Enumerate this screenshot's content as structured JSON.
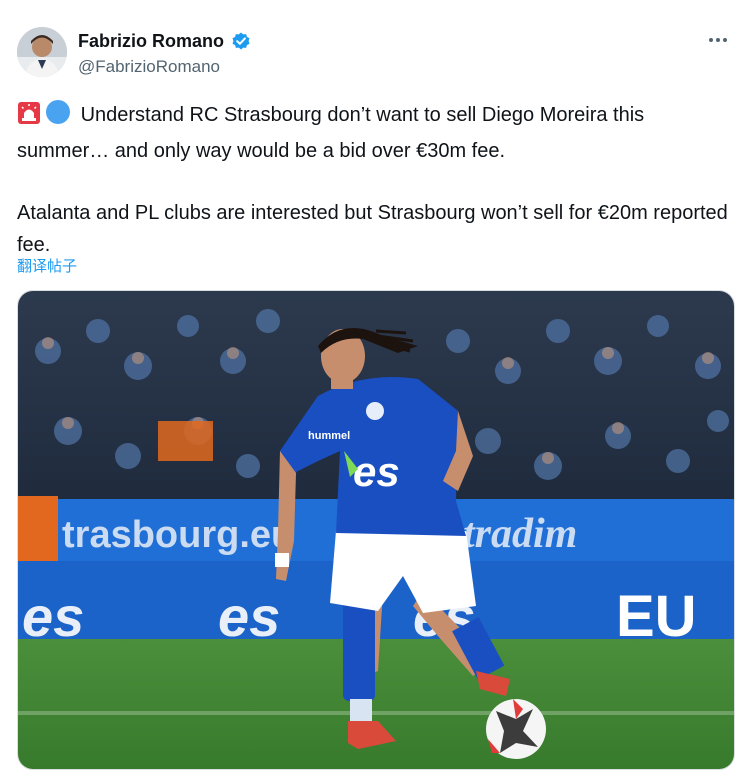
{
  "author": {
    "name": "Fabrizio Romano",
    "handle": "@FabrizioRomano",
    "verified": true
  },
  "tweet": {
    "paragraphs": [
      "Understand RC Strasbourg don’t want to sell Diego Moreira this summer… and only way would be a bid over €30m fee.",
      "Atalanta and PL clubs are interested but Strasbourg won’t sell for €20m reported fee."
    ],
    "lead_emojis": [
      "siren-icon",
      "blue-circle-icon"
    ],
    "translate_label": "翻译帖子"
  },
  "media": {
    "board_texts": [
      "trasbourg.eu",
      "tradim",
      "es",
      "es",
      "es",
      "EU"
    ],
    "shirt_sponsor": "es",
    "shirt_brand": "hummel"
  },
  "colors": {
    "link": "#1d9bf0",
    "verified": "#1d9bf0",
    "kit_blue": "#1a4fc2",
    "board_blue": "#1b63c8",
    "pitch_green": "#3f8a34"
  }
}
